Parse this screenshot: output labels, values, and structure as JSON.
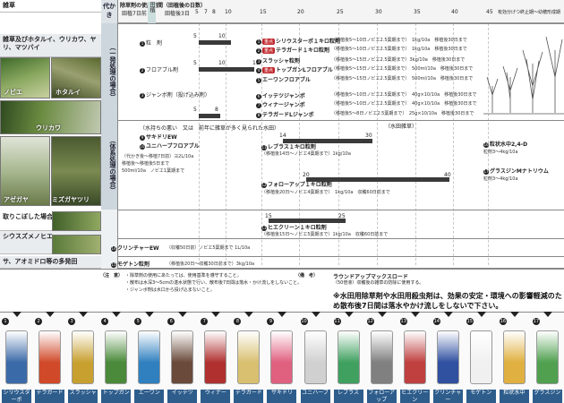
{
  "left": {
    "title_row": "雑草",
    "band1": "雑草及びホタルイ、ウリカワ、ヤリ、マツバイ",
    "weed1": "ノビエ",
    "weed2": "ホタルイ",
    "weed3": "ウリカワ",
    "weed4": "アゼガヤ",
    "weed5": "ミズガヤツリ",
    "band2": "取りこぼした場合",
    "band3": "シウスズメノヒエ",
    "band4": "サ、アオミドロ等の多発田"
  },
  "header": {
    "col_label": "除草剤の使用期間（田植後の日数）",
    "vhead": "代かき",
    "tick_labels": [
      "田植7日前",
      "田植",
      "田植後3日",
      "5",
      "7",
      "8",
      "10",
      "15",
      "20",
      "25",
      "30",
      "35",
      "40",
      "45"
    ],
    "right_label": "有効分げつ終止期〜幼穂形成期"
  },
  "vcols": {
    "v1": "（一発処理の場合）",
    "v2": "（体系処理の場合）"
  },
  "sec1": {
    "r1": {
      "num": "1",
      "name": "粒　剤",
      "start": "5",
      "end": "10"
    },
    "r2": {
      "num": "2",
      "name": "フロアブル剤",
      "start": "5",
      "end": "10",
      "end2": "15"
    },
    "r3": {
      "num": "3",
      "name": "ジャンボ剤（投げ込み剤）",
      "start": "5",
      "end": "8"
    },
    "p1": {
      "num": "1",
      "badge": "重点",
      "name": "シリウスターボ１キロ粒剤"
    },
    "p2": {
      "num": "2",
      "badge": "重点",
      "name": "テラガード１キロ粒剤"
    },
    "p3": {
      "num": "3",
      "name": "スラッシャ粒剤"
    },
    "p4": {
      "num": "4",
      "badge": "重点",
      "name": "トップガンLフロアブル"
    },
    "p5": {
      "num": "5",
      "name": "エーワンフロアブル"
    },
    "p6": {
      "num": "6",
      "name": "イッテツジャンボ"
    },
    "p7": {
      "num": "7",
      "name": "ウィナージャンボ"
    },
    "p8": {
      "num": "8",
      "name": "テラガードLジャンボ"
    },
    "notes": [
      "（移植後5〜10日ノビエ2.5葉期まで）　1kg/10a　移植後30日まで",
      "（移植後5〜10日ノビエ2.5葉期まで）　1kg/10a　移植後30日まで",
      "（移植後5〜15日ノビエ2.5葉期まで）3kg/10a　移植後30日まで",
      "（移植後5〜15日ノビエ2.5葉期まで）　500ml/10a　移植後30日まで",
      "（移植後5〜15日ノビエ2.5葉期まで）　500ml/10a　移植後30日まで",
      "（移植後5〜10日ノビエ2.5葉期まで）　40g×10/10a　移植後30日まで",
      "（移植後5〜10日ノビエ2.5葉期まで）　40g×10/10a　移植後30日まで",
      "（移植後5〜8日ノビエ2.5葉期まで）　25g×10/10a　移植後30日まで"
    ]
  },
  "sec2": {
    "intro": "（水持ちの悪い　又は　前年に雑草が多く見られた水田）",
    "p9": {
      "num": "9",
      "name": "サキドリEW"
    },
    "p10": {
      "num": "10",
      "name": "ユニハーブフロアブル"
    },
    "p11": {
      "num": "11",
      "name": "レブラス１キロ粒剤"
    },
    "p12": {
      "num": "12",
      "name": "フォローアップ１キロ粒剤"
    },
    "n9": "（代かき後〜移植7日前）ヨ2L/10a",
    "n10": "移植後〜移植後5日まで",
    "n10b": "500ml/10a　ノビエ1葉期まで",
    "n11": "（移植後14日〜ノビエ4葉期まで）1kg/10a",
    "n12": "（移植後20日〜ノビエ4葉期まで）　1kg/10a　収穫60日前まで",
    "t11": [
      "14",
      "30"
    ],
    "t12": [
      "20",
      "40"
    ]
  },
  "sec3": {
    "p13": {
      "num": "13",
      "name": "ヒエクリーン１キロ粒剤"
    },
    "n13": "（移植後15日〜ノビエ5葉期まで）1kg/10a　収穫60日前まで",
    "t13": [
      "15",
      "25"
    ]
  },
  "sec4": {
    "p14": {
      "num": "14",
      "name": "クリンチャーEW"
    },
    "n14": "（収穫50日前）ノビエ5葉期まで 1L/10a"
  },
  "sec5": {
    "p15": {
      "num": "15",
      "name": "モゲトン粒剤"
    },
    "n15": "（移植後20日〜収穫30日前まで）3kg/10a"
  },
  "right_side": {
    "herb": "（水田雑草）",
    "p16": {
      "num": "16",
      "name": "粒状水中2,4-D"
    },
    "n16": "粒剤3〜4kg/10a",
    "p17": {
      "num": "17",
      "name": "グラスジンMナトリウム"
    },
    "n17": "粒剤3〜4kg/10a"
  },
  "bottom": {
    "note_title": "（注　意）",
    "notes": [
      "・除草剤の使用にあたっては、使用基準を遵守すること。",
      "・散布は水深3〜5cmの湛水状態で行い、散布後7日間は落水・かけ流しをしないこと。",
      "・ジャンボ剤は水口から投げ込まないこと。"
    ],
    "remark": "（備　考）",
    "roundup": "ラウンドアップマックスロード",
    "roundup_note": "（50倍液）収穫後の雑草の防除に使用する。",
    "warning1": "※水田用除草剤や水田用殺虫剤は、効果の安定・環境への影響軽減のため",
    "warning2": "散布後7日間は落水やかけ流しをしないで下さい。"
  },
  "products": [
    {
      "num": "1",
      "label": "シリウスターボ",
      "color": "#3b6aa8"
    },
    {
      "num": "2",
      "label": "テラガード",
      "color": "#d04a2a"
    },
    {
      "num": "3",
      "label": "スラッシャ",
      "color": "#c8a030"
    },
    {
      "num": "4",
      "label": "トップガン",
      "color": "#4a8a3a"
    },
    {
      "num": "5",
      "label": "エーワン",
      "color": "#3080c0"
    },
    {
      "num": "6",
      "label": "イッテツ",
      "color": "#6a4a3a"
    },
    {
      "num": "7",
      "label": "ウィナー",
      "color": "#b03030"
    },
    {
      "num": "8",
      "label": "テラガード",
      "color": "#d8c070"
    },
    {
      "num": "9",
      "label": "サキドリ",
      "color": "#e06080"
    },
    {
      "num": "10",
      "label": "ユニハーブ",
      "color": "#d0d0d0"
    },
    {
      "num": "11",
      "label": "レブラス",
      "color": "#40a060"
    },
    {
      "num": "12",
      "label": "フォローアップ",
      "color": "#808080"
    },
    {
      "num": "13",
      "label": "ヒエクリーン",
      "color": "#c04040"
    },
    {
      "num": "14",
      "label": "クリンチャー",
      "color": "#3050a0"
    },
    {
      "num": "15",
      "label": "モゲトン",
      "color": "#f0f0f0"
    },
    {
      "num": "16",
      "label": "粒状水中",
      "color": "#e0b040"
    },
    {
      "num": "17",
      "label": "グラスジン",
      "color": "#50a050"
    }
  ]
}
